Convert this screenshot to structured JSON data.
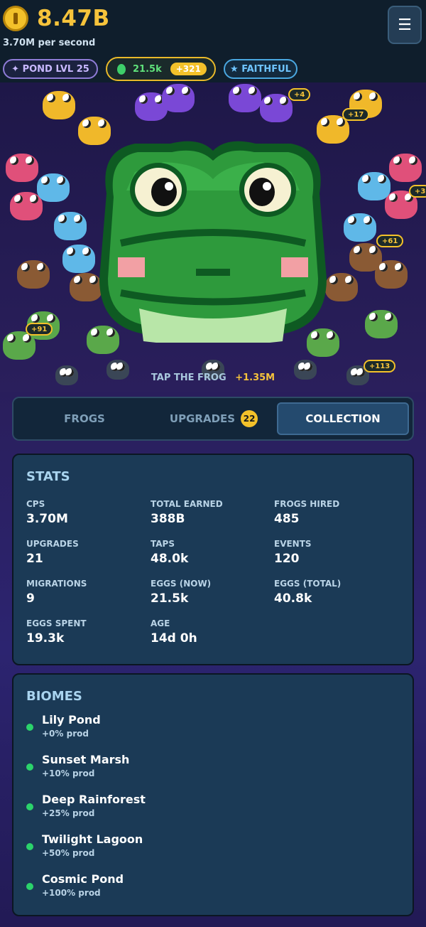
{
  "header": {
    "coins": "8.47B",
    "per_second": "3.70M per second",
    "menu_icon": "☰"
  },
  "pills": {
    "level": "✦ POND LVL 25",
    "eggs": "21.5k",
    "eggs_bonus": "+321",
    "faith": "★ FAITHFUL"
  },
  "pond": {
    "bubbles": [
      "+4",
      "+17",
      "+3",
      "+61",
      "+91",
      "+113"
    ],
    "tap_label": "TAP THE FROG",
    "tap_value": "+1.35M"
  },
  "tabs": {
    "frogs": "FROGS",
    "upgrades": "UPGRADES",
    "upgrades_badge": "22",
    "collection": "COLLECTION"
  },
  "stats": {
    "title": "STATS",
    "items": [
      {
        "label": "CPS",
        "value": "3.70M"
      },
      {
        "label": "TOTAL EARNED",
        "value": "388B"
      },
      {
        "label": "FROGS HIRED",
        "value": "485"
      },
      {
        "label": "UPGRADES",
        "value": "21"
      },
      {
        "label": "TAPS",
        "value": "48.0k"
      },
      {
        "label": "EVENTS",
        "value": "120"
      },
      {
        "label": "MIGRATIONS",
        "value": "9"
      },
      {
        "label": "EGGS (NOW)",
        "value": "21.5k"
      },
      {
        "label": "EGGS (TOTAL)",
        "value": "40.8k"
      },
      {
        "label": "EGGS SPENT",
        "value": "19.3k"
      },
      {
        "label": "AGE",
        "value": "14d 0h"
      }
    ]
  },
  "biomes": {
    "title": "BIOMES",
    "items": [
      {
        "name": "Lily Pond",
        "prod": "+0% prod"
      },
      {
        "name": "Sunset Marsh",
        "prod": "+10% prod"
      },
      {
        "name": "Deep Rainforest",
        "prod": "+25% prod"
      },
      {
        "name": "Twilight Lagoon",
        "prod": "+50% prod"
      },
      {
        "name": "Cosmic Pond",
        "prod": "+100% prod"
      }
    ]
  }
}
